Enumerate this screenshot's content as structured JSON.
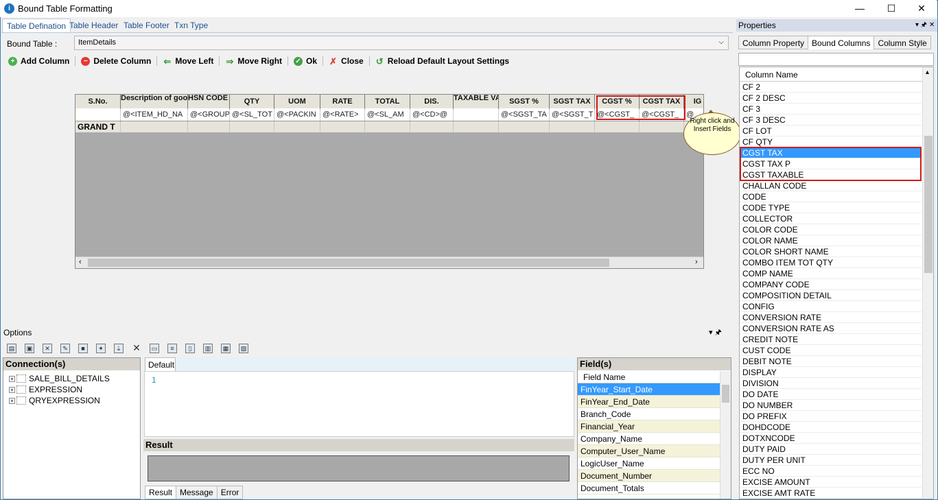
{
  "window": {
    "title": "Bound Table Formatting",
    "minimize": "—",
    "maximize": "☐",
    "close": "✕",
    "icon_letter": "i"
  },
  "tabs": [
    {
      "label": "Table Defination",
      "active": true
    },
    {
      "label": "Table Header"
    },
    {
      "label": "Table Footer"
    },
    {
      "label": "Txn Type"
    }
  ],
  "bound_table": {
    "label": "Bound Table :",
    "value": "ItemDetails"
  },
  "toolbar": {
    "add_column": "Add Column",
    "delete_column": "Delete Column",
    "move_left": "Move Left",
    "move_right": "Move Right",
    "ok": "Ok",
    "close": "Close",
    "reload": "Reload Default Layout Settings"
  },
  "grid": {
    "headers": [
      "S.No.",
      "Description of goods",
      "HSN CODE (GS",
      "QTY",
      "UOM",
      "RATE",
      "TOTAL",
      "DIS.",
      "TAXABLE VAL",
      "SGST %",
      "SGST TAX",
      "CGST %",
      "CGST TAX",
      "IG"
    ],
    "row": [
      "",
      "@<ITEM_HD_NA",
      "@<GROUP",
      "@<SL_TOT",
      "@<PACKIN",
      "@<RATE>",
      "@<SL_AM",
      "@<CD>@",
      "",
      "@<SGST_TA",
      "@<SGST_T",
      "@<CGST_",
      "@<CGST_",
      "@"
    ],
    "total_label": "GRAND T"
  },
  "callout": "Right click and Insert Fields",
  "options": {
    "title": "Options",
    "pin": "▾ 🖈"
  },
  "connections": {
    "title": "Connection(s)",
    "items": [
      "SALE_BILL_DETAILS",
      "EXPRESSION",
      "QRYEXPRESSION"
    ]
  },
  "editor": {
    "tab": "Default",
    "line_no": "1"
  },
  "result": {
    "title": "Result",
    "tabs": [
      "Result",
      "Message",
      "Error"
    ]
  },
  "fields": {
    "title": "Field(s)",
    "column_header": "Field Name",
    "items": [
      "FinYear_Start_Date",
      "FinYear_End_Date",
      "Branch_Code",
      "Financial_Year",
      "Company_Name",
      "Computer_User_Name",
      "LogicUser_Name",
      "Document_Number",
      "Document_Totals"
    ]
  },
  "properties": {
    "title": "Properties",
    "tabs": [
      "Column Property",
      "Bound Columns",
      "Column Style"
    ],
    "active_tab": "Bound Columns",
    "column_header": "Column Name",
    "items": [
      "CF 2",
      "CF 2 DESC",
      "CF 3",
      "CF 3 DESC",
      "CF LOT",
      "CF QTY",
      "CGST TAX",
      "CGST TAX P",
      "CGST TAXABLE",
      "CHALLAN CODE",
      "CODE",
      "CODE TYPE",
      "COLLECTOR",
      "COLOR CODE",
      "COLOR NAME",
      "COLOR SHORT NAME",
      "COMBO ITEM TOT QTY",
      "COMP NAME",
      "COMPANY CODE",
      "COMPOSITION DETAIL",
      "CONFIG",
      "CONVERSION RATE",
      "CONVERSION RATE AS",
      "CREDIT NOTE",
      "CUST CODE",
      "DEBIT NOTE",
      "DISPLAY",
      "DIVISION",
      "DO DATE",
      "DO NUMBER",
      "DO PREFIX",
      "DOHDCODE",
      "DOTXNCODE",
      "DUTY PAID",
      "DUTY PER UNIT",
      "ECC NO",
      "EXCISE AMOUNT",
      "EXCISE AMT RATE"
    ],
    "selected": "CGST TAX"
  }
}
